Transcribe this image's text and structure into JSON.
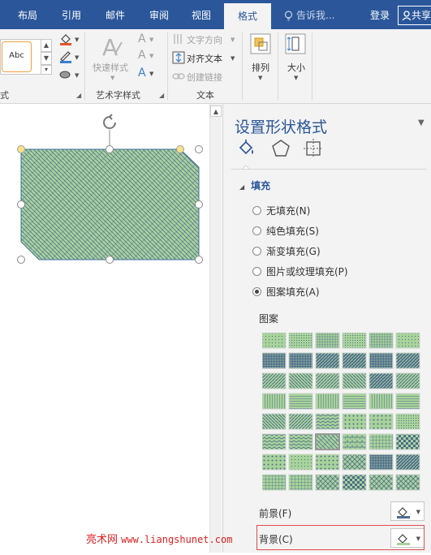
{
  "tabs": {
    "layout": "布局",
    "references": "引用",
    "mailings": "邮件",
    "review": "审阅",
    "view": "视图",
    "format": "格式"
  },
  "tell_me": "告诉我...",
  "login": "登录",
  "share": "共享",
  "ribbon": {
    "shape_style_sample": "Abc",
    "quick_styles": "快速样式",
    "wordart_group": "艺术字样式",
    "text_direction": "文字方向",
    "align_text": "对齐文本",
    "create_link": "创建链接",
    "text_group": "文本",
    "arrange": "排列",
    "size": "大小",
    "group_partial_label": "式"
  },
  "panel": {
    "title": "设置形状格式",
    "fill_section": "填充",
    "options": [
      {
        "label": "无填充(N)",
        "checked": false
      },
      {
        "label": "纯色填充(S)",
        "checked": false
      },
      {
        "label": "渐变填充(G)",
        "checked": false
      },
      {
        "label": "图片或纹理填充(P)",
        "checked": false
      },
      {
        "label": "图案填充(A)",
        "checked": true
      }
    ],
    "pattern_label": "图案",
    "foreground_label": "前景(F)",
    "background_label": "背景(C)"
  },
  "watermark": {
    "site": "亮术网",
    "url": "www.liangshunet.com"
  },
  "colors": {
    "accent": "#2b579a",
    "fill": "#a8d39a",
    "hatch": "#4f6b8f",
    "highlight": "#e24b4b"
  }
}
